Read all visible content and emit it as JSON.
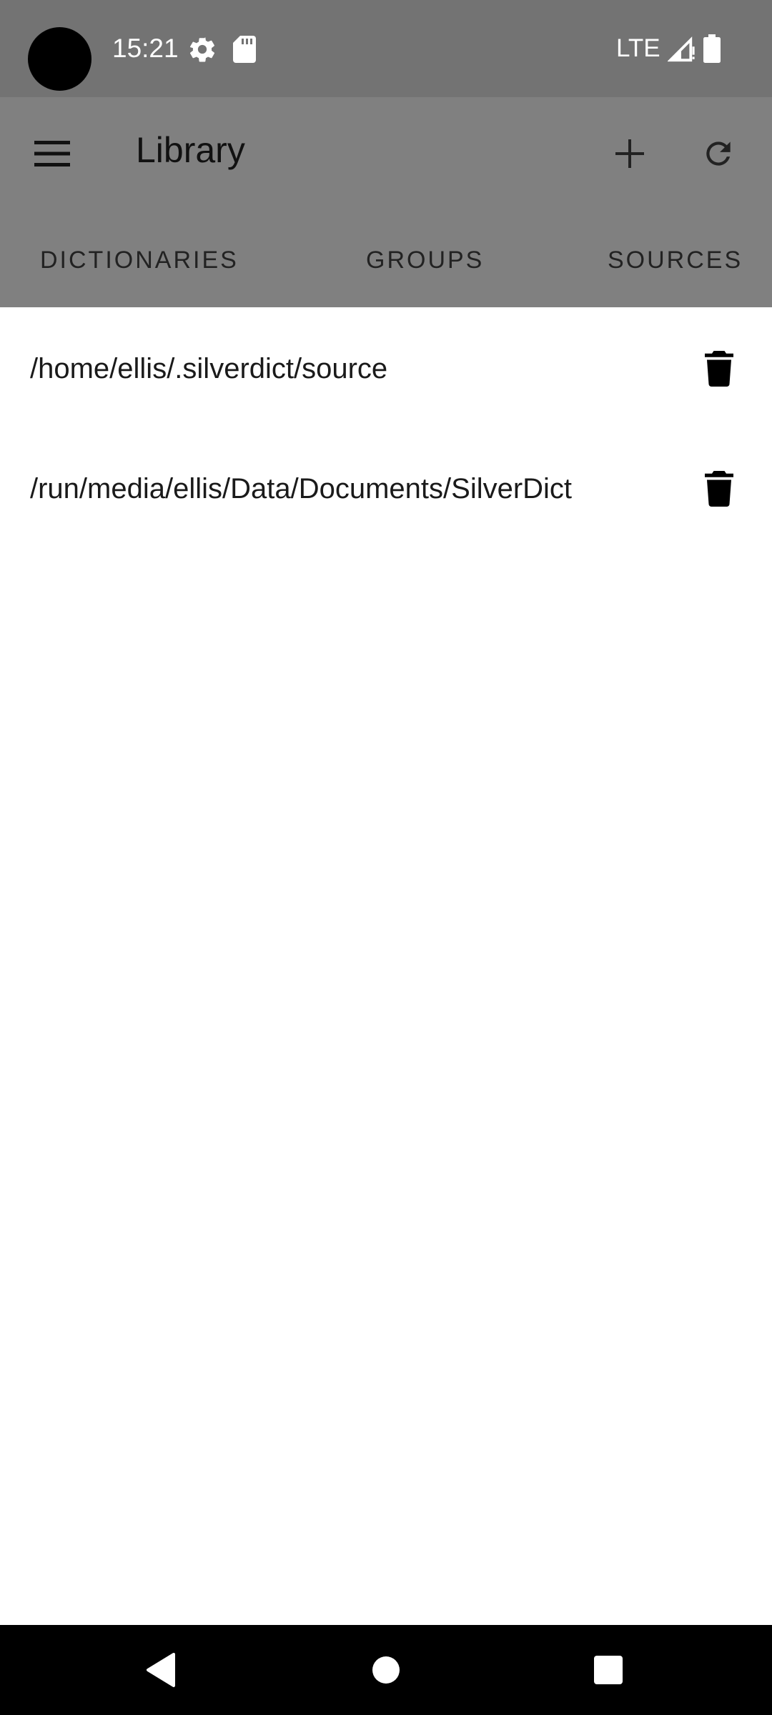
{
  "status_bar": {
    "time": "15:21",
    "network": "LTE",
    "icons": [
      "settings-gear-icon",
      "sd-card-icon",
      "signal-icon",
      "battery-icon"
    ]
  },
  "app_bar": {
    "title": "Library",
    "menu_icon": "hamburger-menu-icon",
    "add_icon": "plus-icon",
    "refresh_icon": "refresh-icon"
  },
  "tabs": [
    {
      "label": "DICTIONARIES"
    },
    {
      "label": "GROUPS"
    },
    {
      "label": "SOURCES"
    }
  ],
  "sources": [
    {
      "path": "/home/ellis/.silverdict/source"
    },
    {
      "path": "/run/media/ellis/Data/Documents/SilverDict"
    }
  ],
  "nav_bar": {
    "back_icon": "back-triangle-icon",
    "home_icon": "home-circle-icon",
    "recents_icon": "recents-square-icon"
  },
  "colors": {
    "status_bar_bg": "#737373",
    "app_bar_bg": "#808080",
    "content_bg": "#ffffff",
    "nav_bar_bg": "#000000"
  }
}
